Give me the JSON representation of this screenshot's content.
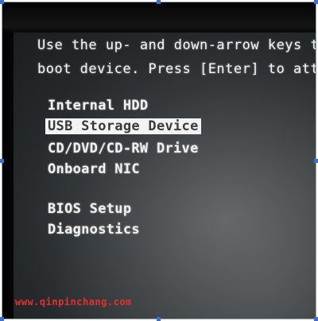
{
  "instructions": {
    "line1": "Use the up- and down-arrow keys to mov",
    "line2": "boot device. Press [Enter] to attempt"
  },
  "boot_menu": {
    "items": [
      {
        "label": "Internal HDD",
        "selected": false
      },
      {
        "label": "USB Storage Device",
        "selected": true
      },
      {
        "label": "CD/DVD/CD-RW Drive",
        "selected": false
      },
      {
        "label": "Onboard NIC",
        "selected": false
      }
    ],
    "other_items": [
      {
        "label": "BIOS Setup"
      },
      {
        "label": "Diagnostics"
      }
    ]
  },
  "watermark": "www.qinpinchang.com",
  "colors": {
    "screen_text": "#f2f2f2",
    "highlight_bg": "#f4f4f4",
    "highlight_text": "#3a3a3a",
    "watermark": "#e3322d",
    "corner_marks": "#3d6fd1"
  }
}
